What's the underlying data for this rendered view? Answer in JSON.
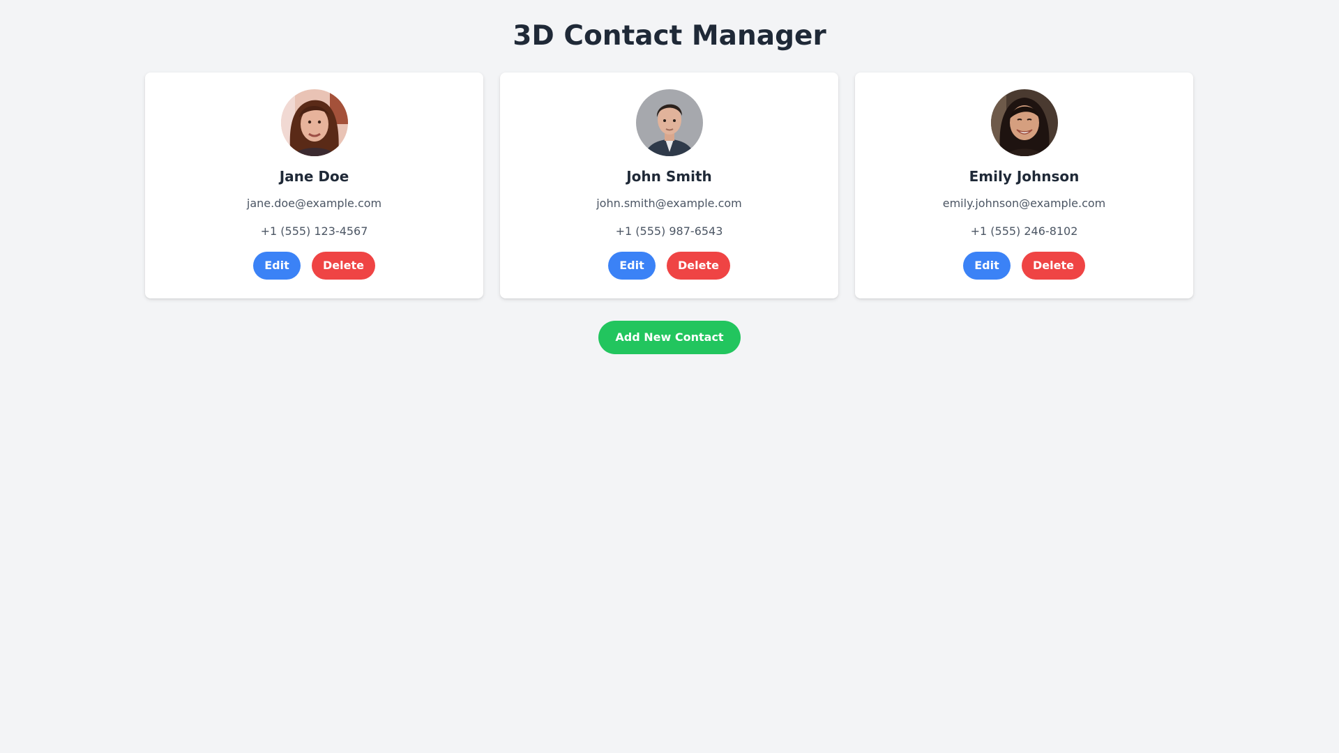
{
  "header": {
    "title": "3D Contact Manager"
  },
  "contacts": [
    {
      "name": "Jane Doe",
      "email": "jane.doe@example.com",
      "phone": "+1 (555) 123-4567",
      "edit_label": "Edit",
      "delete_label": "Delete"
    },
    {
      "name": "John Smith",
      "email": "john.smith@example.com",
      "phone": "+1 (555) 987-6543",
      "edit_label": "Edit",
      "delete_label": "Delete"
    },
    {
      "name": "Emily Johnson",
      "email": "emily.johnson@example.com",
      "phone": "+1 (555) 246-8102",
      "edit_label": "Edit",
      "delete_label": "Delete"
    }
  ],
  "actions": {
    "add_label": "Add New Contact"
  },
  "colors": {
    "background": "#f3f4f6",
    "edit": "#3b82f6",
    "delete": "#ef4444",
    "add": "#22c55e",
    "title": "#1f2937"
  }
}
